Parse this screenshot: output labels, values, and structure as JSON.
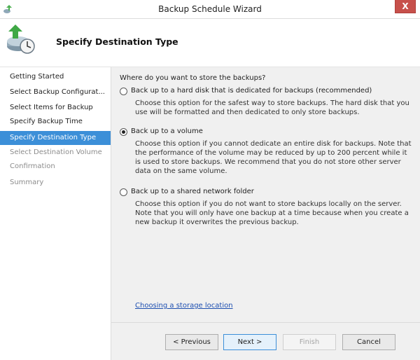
{
  "window": {
    "title": "Backup Schedule Wizard",
    "close_glyph": "X"
  },
  "header": {
    "heading": "Specify Destination Type"
  },
  "sidebar": {
    "steps": [
      {
        "label": "Getting Started",
        "state": "done"
      },
      {
        "label": "Select Backup Configurat...",
        "state": "done"
      },
      {
        "label": "Select Items for Backup",
        "state": "done"
      },
      {
        "label": "Specify Backup Time",
        "state": "done"
      },
      {
        "label": "Specify Destination Type",
        "state": "current"
      },
      {
        "label": "Select Destination Volume",
        "state": "future"
      },
      {
        "label": "Confirmation",
        "state": "future"
      },
      {
        "label": "Summary",
        "state": "future"
      }
    ]
  },
  "main": {
    "question": "Where do you want to store the backups?",
    "options": [
      {
        "label": "Back up to a hard disk that is dedicated for backups (recommended)",
        "description": "Choose this option for the safest way to store backups. The hard disk that you use will be formatted and then dedicated to only store backups.",
        "selected": false
      },
      {
        "label": "Back up to a volume",
        "description": "Choose this option if you cannot dedicate an entire disk for backups. Note that the performance of the volume may be reduced by up to 200 percent while it is used to store backups. We recommend that you do not store other server data on the same volume.",
        "selected": true
      },
      {
        "label": "Back up to a shared network folder",
        "description": "Choose this option if you do not want to store backups locally on the server. Note that you will only have one backup at a time because when you create a new backup it overwrites the previous backup.",
        "selected": false
      }
    ],
    "link": "Choosing a storage location"
  },
  "buttons": {
    "previous": "< Previous",
    "next": "Next >",
    "finish": "Finish",
    "cancel": "Cancel"
  },
  "colors": {
    "current_step": "#3c8fd8",
    "link": "#1c4eb0",
    "close_button": "#c7504b"
  }
}
